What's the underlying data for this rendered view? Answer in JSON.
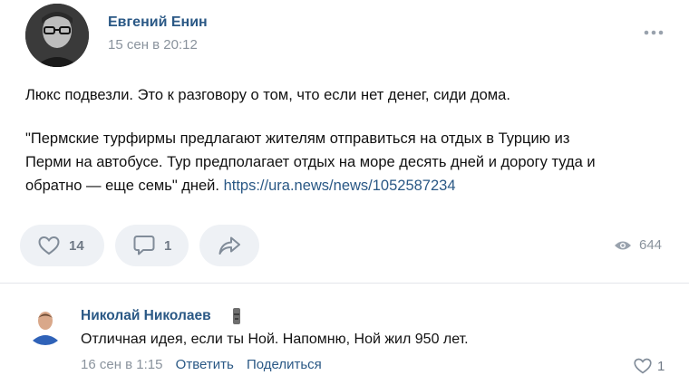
{
  "post": {
    "author": "Евгений Енин",
    "time": "15 сен в 20:12",
    "text_lines": [
      "Люкс подвезли. Это к разговору о том, что если нет денег, сиди дома.",
      "\"Пермские турфирмы предлагают жителям отправиться на отдых в Турцию из",
      "Перми на автобусе. Тур предполагает отдых на море десять дней и дорогу туда и",
      "обратно — еще семь\" дней. "
    ],
    "link": "https://ura.news/news/1052587234",
    "likes": "14",
    "comments": "1",
    "views": "644",
    "icons": {
      "more": "more-dots-icon",
      "like": "heart-icon",
      "comment": "comment-icon",
      "share": "share-arrow-icon",
      "views": "eye-icon"
    }
  },
  "comment": {
    "author": "Николай Николаев",
    "text": "Отличная идея, если ты Ной. Напомню, Ной жил 950 лет.",
    "time": "16 сен в 1:15",
    "reply_label": "Ответить",
    "share_label": "Поделиться",
    "likes": "1",
    "badge_icon": "moai-badge-icon"
  },
  "colors": {
    "link": "#2a5885",
    "muted": "#8a939d",
    "button_bg": "#eef1f5"
  }
}
